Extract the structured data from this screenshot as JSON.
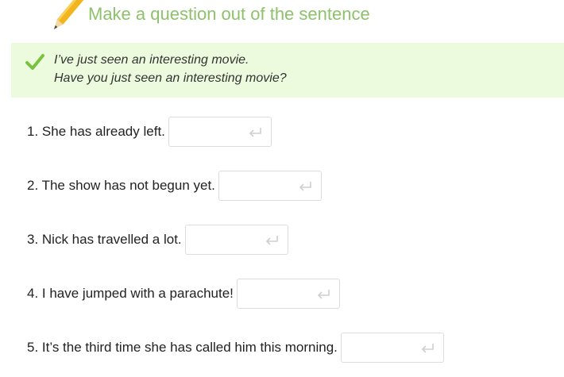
{
  "task": {
    "title": "Make a question out of the sentence"
  },
  "example": {
    "sentence": "I’ve just seen an interesting movie.",
    "answer": "Have you just seen an interesting movie?"
  },
  "questions": [
    {
      "text": "1. She has already left.",
      "answer_value": ""
    },
    {
      "text": "2. The show has not begun yet.",
      "answer_value": ""
    },
    {
      "text": "3. Nick has travelled a lot.",
      "answer_value": ""
    },
    {
      "text": "4. I have jumped with a parachute!",
      "answer_value": ""
    },
    {
      "text": "5. It’s the third time she has called him this morning.",
      "answer_value": ""
    }
  ],
  "icons": {
    "header": "pencil-icon",
    "example": "checkmark-icon",
    "submit": "enter-icon"
  },
  "colors": {
    "title": "#8dc26b",
    "example_bg": "#ecfbdd",
    "check": "#7ac142"
  }
}
